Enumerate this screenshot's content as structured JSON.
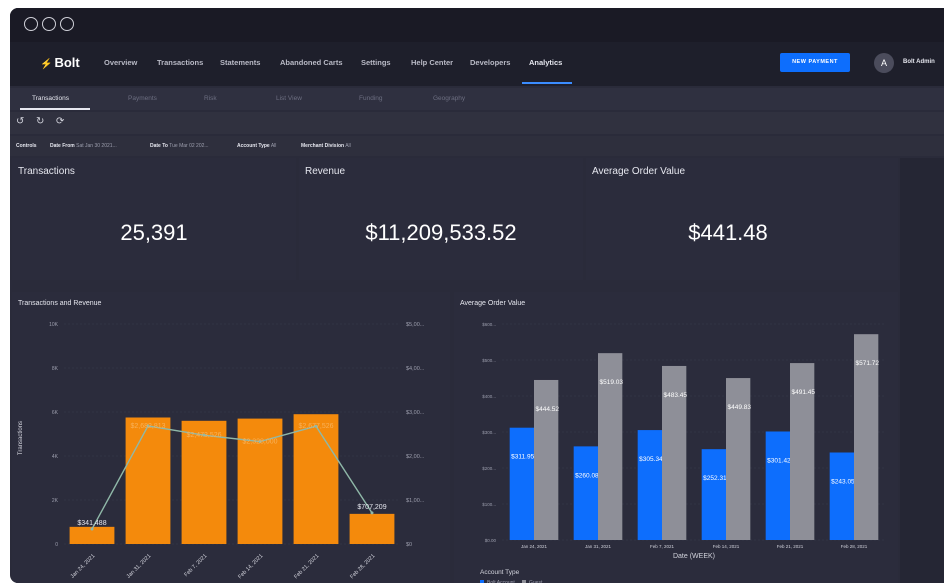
{
  "window_controls": [
    "close",
    "minimize",
    "maximize"
  ],
  "nav": {
    "logo_icon": "bolt-icon",
    "logo": "Bolt",
    "items": [
      "Overview",
      "Transactions",
      "Statements",
      "Abandoned Carts",
      "Settings",
      "Help Center",
      "Developers",
      "Analytics"
    ],
    "active": "Analytics",
    "new_payment": "NEW PAYMENT",
    "avatar": "A",
    "user": "Bolt Admin"
  },
  "subtabs": {
    "items": [
      "Transactions",
      "Payments",
      "Risk",
      "List View",
      "Funding",
      "Geography"
    ],
    "active": "Transactions"
  },
  "toolbar": {
    "icons": [
      "undo-icon",
      "redo-icon",
      "reset-icon"
    ],
    "glyphs": [
      "↺",
      "↻",
      "⟳"
    ]
  },
  "controls": {
    "label": "Controls",
    "date_from_label": "Date From",
    "date_from": "Sat Jan 30 2021...",
    "date_to_label": "Date To",
    "date_to": "Tue Mar 02 202...",
    "account_type_label": "Account Type",
    "account_type": "All",
    "merchant_label": "Merchant Division",
    "merchant": "All"
  },
  "kpis": {
    "transactions": {
      "title": "Transactions",
      "value": "25,391"
    },
    "revenue": {
      "title": "Revenue",
      "value": "$11,209,533.52"
    },
    "aov": {
      "title": "Average Order Value",
      "value": "$441.48"
    }
  },
  "chart_data": [
    {
      "type": "bar",
      "title": "Transactions and Revenue",
      "ylabel": "Transactions",
      "categories": [
        "Jan 24, 2021",
        "Jan 31, 2021",
        "Feb 7, 2021",
        "Feb 14, 2021",
        "Feb 21, 2021",
        "Feb 28, 2021"
      ],
      "left_ticks": [
        "0",
        "2K",
        "4K",
        "6K",
        "8K",
        "10K"
      ],
      "right_ticks": [
        "$0",
        "$1,00...",
        "$2,00...",
        "$3,00...",
        "$4,00...",
        "$5,00..."
      ],
      "ylim": [
        0,
        10000
      ],
      "y2lim": [
        0,
        5000000
      ],
      "series": [
        {
          "name": "Transactions",
          "type": "bar",
          "color": "#f48a0c",
          "values": [
            780,
            5750,
            5600,
            5700,
            5900,
            1370
          ]
        },
        {
          "name": "Revenue",
          "type": "line",
          "color": "#8fb8a8",
          "values": [
            341488,
            2682813,
            2473526,
            2328000,
            2677526,
            707209
          ]
        }
      ],
      "data_labels": [
        "$341,488",
        "$2,682,813",
        "$2,473,526",
        "$2,328,000",
        "$2,677,526",
        "$707,209"
      ]
    },
    {
      "type": "bar",
      "title": "Average Order Value",
      "xlabel": "Date (WEEK)",
      "categories": [
        "Jan 24, 2021",
        "Jan 31, 2021",
        "Feb 7, 2021",
        "Feb 14, 2021",
        "Feb 21, 2021",
        "Feb 28, 2021"
      ],
      "y_ticks": [
        "$0.00",
        "$100...",
        "$200...",
        "$300...",
        "$400...",
        "$500...",
        "$600..."
      ],
      "ylim": [
        0,
        600
      ],
      "series": [
        {
          "name": "Bolt Account",
          "color": "#0d6efd",
          "values": [
            311.95,
            260.08,
            305.34,
            252.31,
            301.42,
            243.05
          ],
          "labels": [
            "$311.95",
            "$260.08",
            "$305.34",
            "$252.31",
            "$301.42",
            "$243.05"
          ]
        },
        {
          "name": "Guest",
          "color": "#8e8f98",
          "values": [
            444.52,
            519.03,
            483.45,
            449.83,
            491.45,
            571.72
          ],
          "labels": [
            "$444.52",
            "$519.03",
            "$483.45",
            "$449.83",
            "$491.45",
            "$571.72"
          ]
        }
      ],
      "legend_title": "Account Type",
      "legend": "bottom-left"
    }
  ]
}
